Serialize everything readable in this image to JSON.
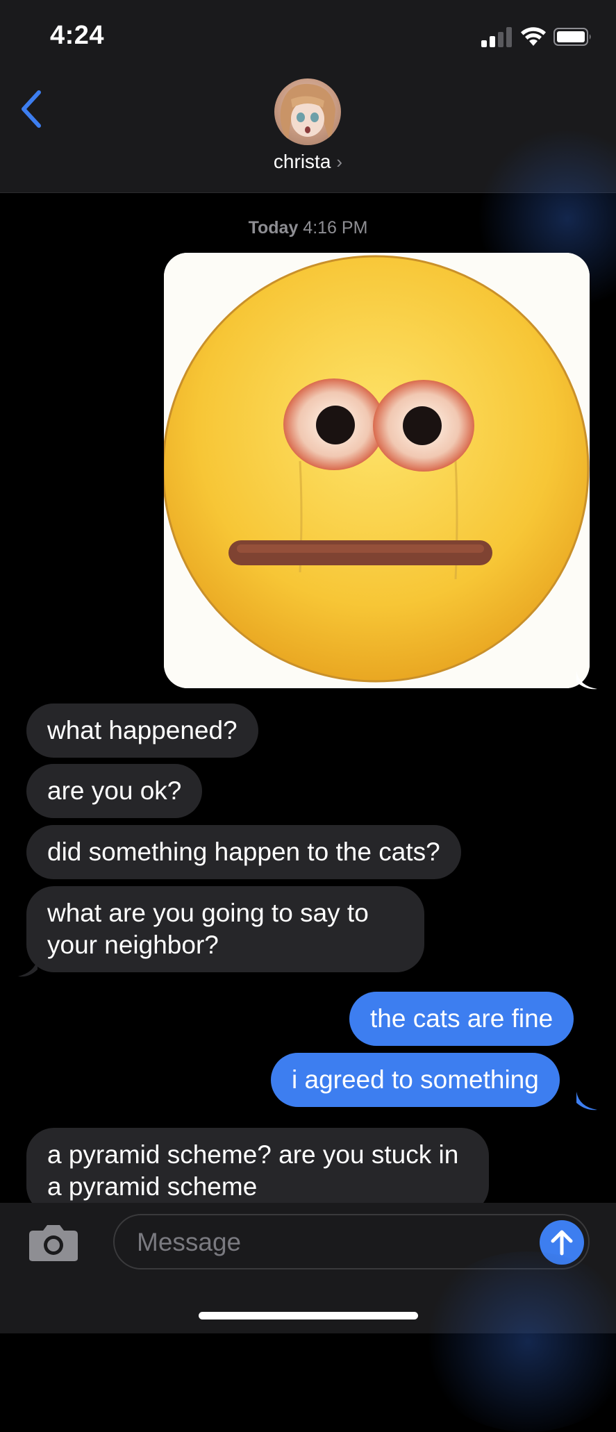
{
  "status_bar": {
    "time": "4:24"
  },
  "header": {
    "contact_name": "christa",
    "chevron": "›"
  },
  "thread": {
    "timestamp_day": "Today",
    "timestamp_time": "4:16 PM",
    "messages": [
      {
        "type": "image",
        "direction": "outgoing",
        "description": "cursed-crying-emoji-image"
      },
      {
        "type": "text",
        "direction": "incoming",
        "text": "what happened?"
      },
      {
        "type": "text",
        "direction": "incoming",
        "text": "are you ok?"
      },
      {
        "type": "text",
        "direction": "incoming",
        "text": "did something happen to the cats?"
      },
      {
        "type": "text",
        "direction": "incoming",
        "text": "what are you going to say to your neighbor?"
      },
      {
        "type": "text",
        "direction": "outgoing",
        "text": "the cats are fine"
      },
      {
        "type": "text",
        "direction": "outgoing",
        "text": "i agreed to something"
      },
      {
        "type": "text",
        "direction": "incoming",
        "text": "a pyramid scheme? are you stuck in a pyramid scheme"
      }
    ]
  },
  "composer": {
    "placeholder": "Message"
  },
  "colors": {
    "outgoing": "#3d7ef0",
    "incoming": "#262629",
    "accent": "#3d7ef0"
  },
  "icons": [
    "back-chevron-icon",
    "camera-icon",
    "send-arrow-icon",
    "wifi-icon",
    "battery-icon",
    "signal-icon"
  ]
}
